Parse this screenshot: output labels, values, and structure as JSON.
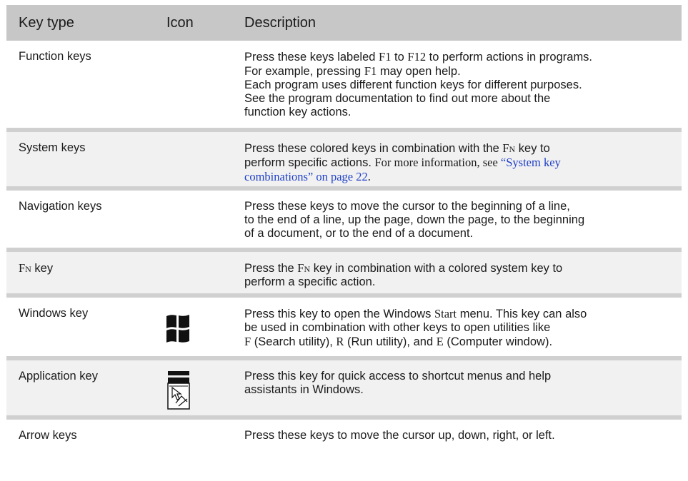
{
  "header": {
    "col_key": "Key type",
    "col_icon": "Icon",
    "col_desc": "Description"
  },
  "rows": [
    {
      "key": "Function keys",
      "desc": {
        "p1": "Press these keys labeled ",
        "f1": "F1",
        "p2": " to ",
        "f12": "F12",
        "p3": " to perform actions in programs.",
        "p4": "For example, pressing ",
        "f1b": "F1",
        "p5": " may open help.",
        "p6": "Each program uses different function keys for different purposes.",
        "p7": "See the program documentation to find out more about the",
        "p8": "function key actions."
      }
    },
    {
      "key": "System keys",
      "desc": {
        "p1": "Press these colored keys in combination with the ",
        "fn": "Fn",
        "p2": " key to",
        "p3": "perform specific actions. ",
        "p4": "For more information, see ",
        "link1": "“System key",
        "link2": "combinations” on page 22",
        "p5": "."
      }
    },
    {
      "key": "Navigation keys",
      "desc": {
        "l1": "Press these keys to move the cursor to the beginning of a line,",
        "l2": "to the end of a line, up the page, down the page, to the beginning",
        "l3": "of a document, or to the end of a document."
      }
    },
    {
      "key_fn": "Fn",
      "key_rest": " key",
      "desc": {
        "p1": "Press the ",
        "fn": "Fn",
        "p2": " key in combination with a colored system key to",
        "p3": "perform a specific action."
      }
    },
    {
      "key": "Windows key",
      "icon": "windows-logo-icon",
      "desc": {
        "p1": "Press this key to open the Windows ",
        "start": "Start",
        "p2": " menu. This key can also",
        "p3": "be used in combination with other keys to open utilities like",
        "kf": "F",
        "p4": " (Search utility), ",
        "kr": "R",
        "p5": " (Run utility), and ",
        "ke": "E",
        "p6": " (Computer window)."
      }
    },
    {
      "key": "Application key",
      "icon": "application-menu-icon",
      "desc": {
        "l1": "Press this key for quick access to shortcut menus and help",
        "l2": "assistants in Windows."
      }
    },
    {
      "key": "Arrow keys",
      "desc": {
        "l1": "Press these keys to move the cursor up, down, right, or left."
      }
    }
  ]
}
